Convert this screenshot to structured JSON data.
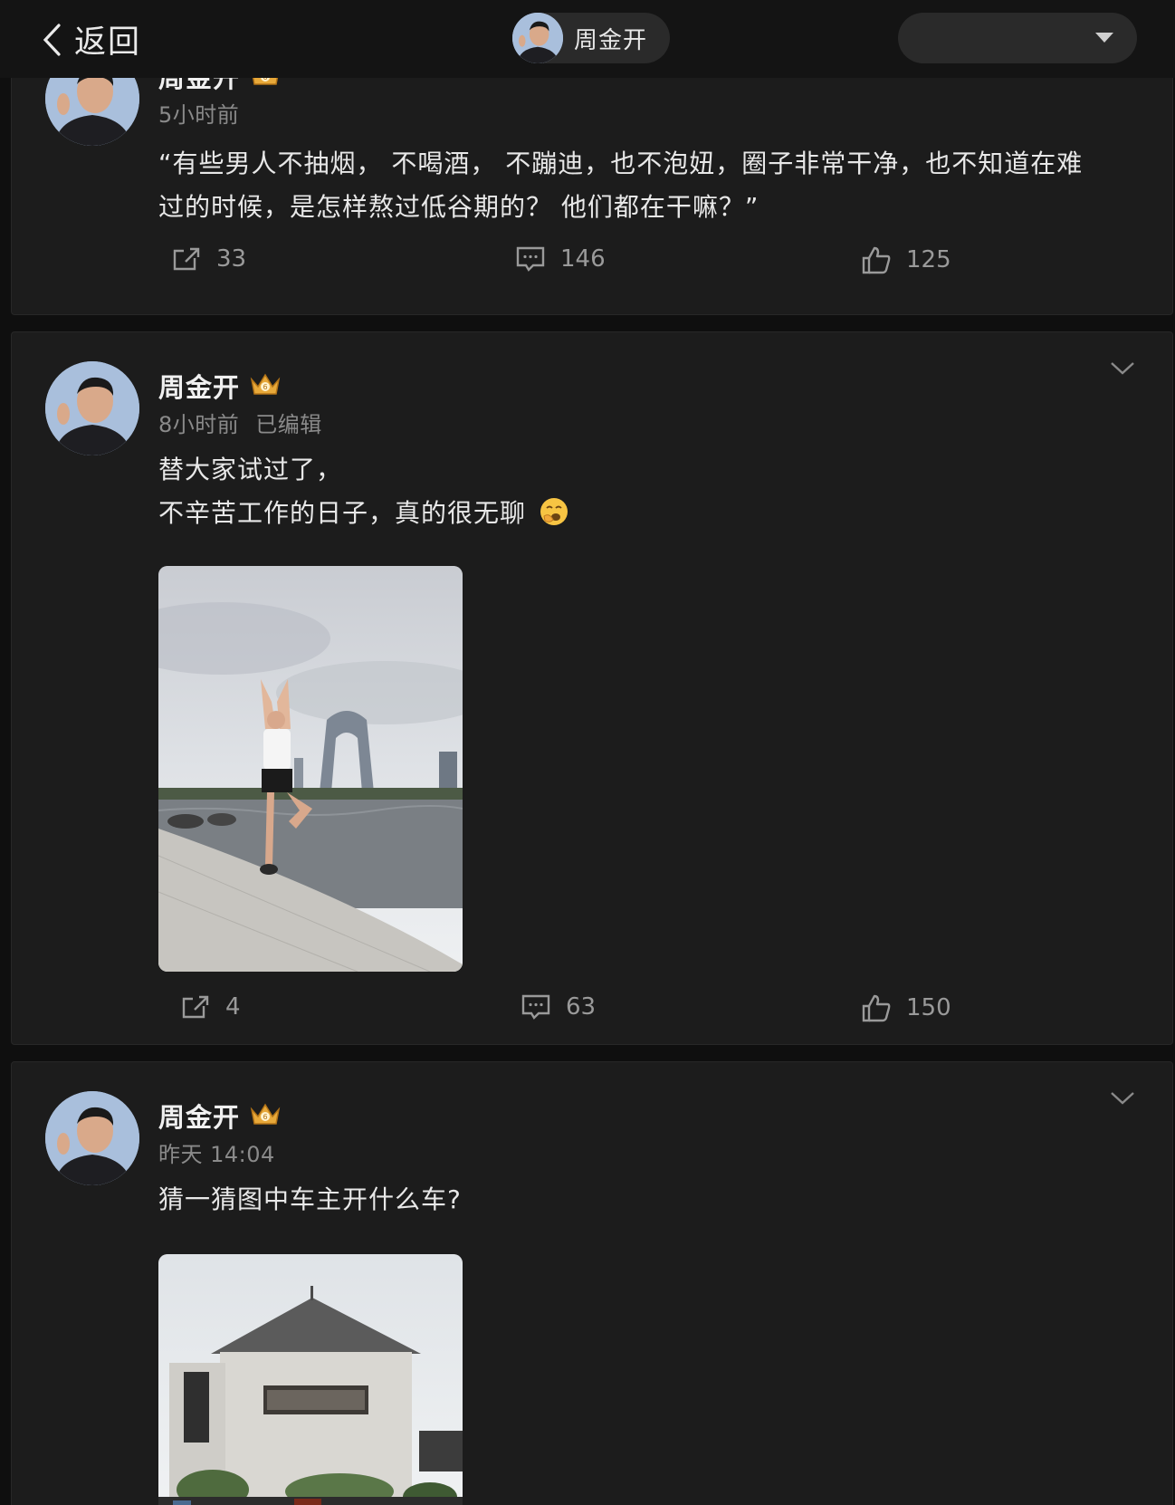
{
  "topbar": {
    "back_label": "返回",
    "profile_name": "周金开"
  },
  "posts": [
    {
      "user": "周金开",
      "time": "5小时前",
      "edited": "",
      "text_lines": [
        "“有些男人不抽烟， 不喝酒， 不蹦迪，也不泡妞，圈子非常干净，也不知道在难",
        "过的时候，是怎样熬过低谷期的？ 他们都在干嘛？”"
      ],
      "reposts": "33",
      "comments": "146",
      "likes": "125"
    },
    {
      "user": "周金开",
      "time": "8小时前",
      "edited": "已编辑",
      "text_lines": [
        "替大家试过了，",
        "不辛苦工作的日子，真的很无聊"
      ],
      "emoji": "yawn-emoji",
      "image": "photo-person-yoga-pose-by-lake",
      "reposts": "4",
      "comments": "63",
      "likes": "150"
    },
    {
      "user": "周金开",
      "time": "昨天 14:04",
      "edited": "",
      "text_lines": [
        "猜一猜图中车主开什么车?"
      ],
      "image": "photo-white-house-building"
    }
  ],
  "colors": {
    "page_bg": "#0f0f0f",
    "card_bg": "#1c1c1c",
    "text": "#e8e8e8",
    "muted": "#8a8a8a"
  }
}
